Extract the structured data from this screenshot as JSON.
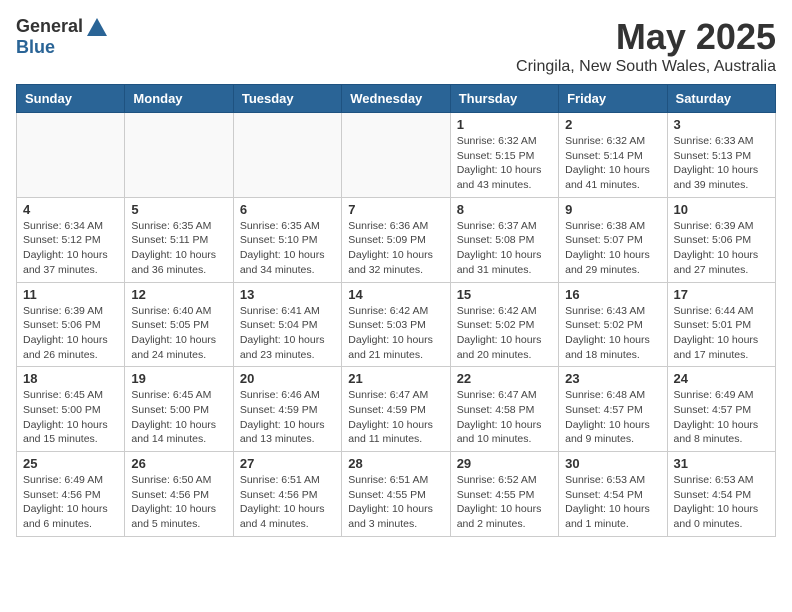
{
  "logo": {
    "general": "General",
    "blue": "Blue"
  },
  "title": "May 2025",
  "location": "Cringila, New South Wales, Australia",
  "days_of_week": [
    "Sunday",
    "Monday",
    "Tuesday",
    "Wednesday",
    "Thursday",
    "Friday",
    "Saturday"
  ],
  "weeks": [
    [
      {
        "day": "",
        "info": ""
      },
      {
        "day": "",
        "info": ""
      },
      {
        "day": "",
        "info": ""
      },
      {
        "day": "",
        "info": ""
      },
      {
        "day": "1",
        "info": "Sunrise: 6:32 AM\nSunset: 5:15 PM\nDaylight: 10 hours\nand 43 minutes."
      },
      {
        "day": "2",
        "info": "Sunrise: 6:32 AM\nSunset: 5:14 PM\nDaylight: 10 hours\nand 41 minutes."
      },
      {
        "day": "3",
        "info": "Sunrise: 6:33 AM\nSunset: 5:13 PM\nDaylight: 10 hours\nand 39 minutes."
      }
    ],
    [
      {
        "day": "4",
        "info": "Sunrise: 6:34 AM\nSunset: 5:12 PM\nDaylight: 10 hours\nand 37 minutes."
      },
      {
        "day": "5",
        "info": "Sunrise: 6:35 AM\nSunset: 5:11 PM\nDaylight: 10 hours\nand 36 minutes."
      },
      {
        "day": "6",
        "info": "Sunrise: 6:35 AM\nSunset: 5:10 PM\nDaylight: 10 hours\nand 34 minutes."
      },
      {
        "day": "7",
        "info": "Sunrise: 6:36 AM\nSunset: 5:09 PM\nDaylight: 10 hours\nand 32 minutes."
      },
      {
        "day": "8",
        "info": "Sunrise: 6:37 AM\nSunset: 5:08 PM\nDaylight: 10 hours\nand 31 minutes."
      },
      {
        "day": "9",
        "info": "Sunrise: 6:38 AM\nSunset: 5:07 PM\nDaylight: 10 hours\nand 29 minutes."
      },
      {
        "day": "10",
        "info": "Sunrise: 6:39 AM\nSunset: 5:06 PM\nDaylight: 10 hours\nand 27 minutes."
      }
    ],
    [
      {
        "day": "11",
        "info": "Sunrise: 6:39 AM\nSunset: 5:06 PM\nDaylight: 10 hours\nand 26 minutes."
      },
      {
        "day": "12",
        "info": "Sunrise: 6:40 AM\nSunset: 5:05 PM\nDaylight: 10 hours\nand 24 minutes."
      },
      {
        "day": "13",
        "info": "Sunrise: 6:41 AM\nSunset: 5:04 PM\nDaylight: 10 hours\nand 23 minutes."
      },
      {
        "day": "14",
        "info": "Sunrise: 6:42 AM\nSunset: 5:03 PM\nDaylight: 10 hours\nand 21 minutes."
      },
      {
        "day": "15",
        "info": "Sunrise: 6:42 AM\nSunset: 5:02 PM\nDaylight: 10 hours\nand 20 minutes."
      },
      {
        "day": "16",
        "info": "Sunrise: 6:43 AM\nSunset: 5:02 PM\nDaylight: 10 hours\nand 18 minutes."
      },
      {
        "day": "17",
        "info": "Sunrise: 6:44 AM\nSunset: 5:01 PM\nDaylight: 10 hours\nand 17 minutes."
      }
    ],
    [
      {
        "day": "18",
        "info": "Sunrise: 6:45 AM\nSunset: 5:00 PM\nDaylight: 10 hours\nand 15 minutes."
      },
      {
        "day": "19",
        "info": "Sunrise: 6:45 AM\nSunset: 5:00 PM\nDaylight: 10 hours\nand 14 minutes."
      },
      {
        "day": "20",
        "info": "Sunrise: 6:46 AM\nSunset: 4:59 PM\nDaylight: 10 hours\nand 13 minutes."
      },
      {
        "day": "21",
        "info": "Sunrise: 6:47 AM\nSunset: 4:59 PM\nDaylight: 10 hours\nand 11 minutes."
      },
      {
        "day": "22",
        "info": "Sunrise: 6:47 AM\nSunset: 4:58 PM\nDaylight: 10 hours\nand 10 minutes."
      },
      {
        "day": "23",
        "info": "Sunrise: 6:48 AM\nSunset: 4:57 PM\nDaylight: 10 hours\nand 9 minutes."
      },
      {
        "day": "24",
        "info": "Sunrise: 6:49 AM\nSunset: 4:57 PM\nDaylight: 10 hours\nand 8 minutes."
      }
    ],
    [
      {
        "day": "25",
        "info": "Sunrise: 6:49 AM\nSunset: 4:56 PM\nDaylight: 10 hours\nand 6 minutes."
      },
      {
        "day": "26",
        "info": "Sunrise: 6:50 AM\nSunset: 4:56 PM\nDaylight: 10 hours\nand 5 minutes."
      },
      {
        "day": "27",
        "info": "Sunrise: 6:51 AM\nSunset: 4:56 PM\nDaylight: 10 hours\nand 4 minutes."
      },
      {
        "day": "28",
        "info": "Sunrise: 6:51 AM\nSunset: 4:55 PM\nDaylight: 10 hours\nand 3 minutes."
      },
      {
        "day": "29",
        "info": "Sunrise: 6:52 AM\nSunset: 4:55 PM\nDaylight: 10 hours\nand 2 minutes."
      },
      {
        "day": "30",
        "info": "Sunrise: 6:53 AM\nSunset: 4:54 PM\nDaylight: 10 hours\nand 1 minute."
      },
      {
        "day": "31",
        "info": "Sunrise: 6:53 AM\nSunset: 4:54 PM\nDaylight: 10 hours\nand 0 minutes."
      }
    ]
  ]
}
